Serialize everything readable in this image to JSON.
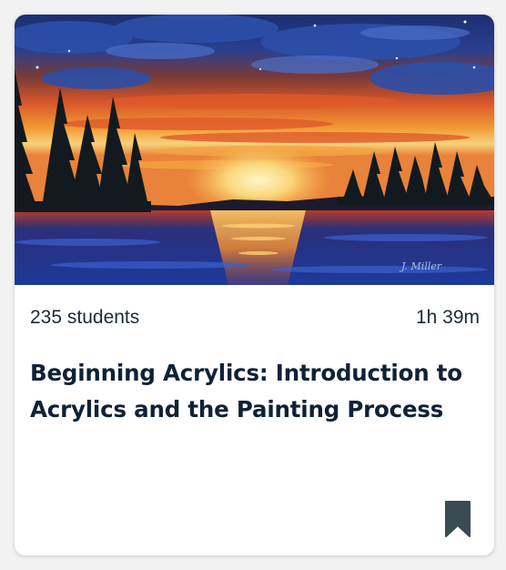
{
  "card": {
    "students": "235 students",
    "duration": "1h 39m",
    "title": "Beginning Acrylics: Introduction to Acrylics and the Painting Process",
    "thumbnail_alt": "Acrylic sunset painting over a lake with pine trees",
    "signature": "J. Miller"
  },
  "colors": {
    "text": "#0f2235",
    "meta_text": "#1b2a36",
    "bookmark": "#3a4b52",
    "card_bg": "#ffffff",
    "page_bg": "#f2f2f2"
  },
  "icons": {
    "bookmark": "bookmark-icon"
  }
}
